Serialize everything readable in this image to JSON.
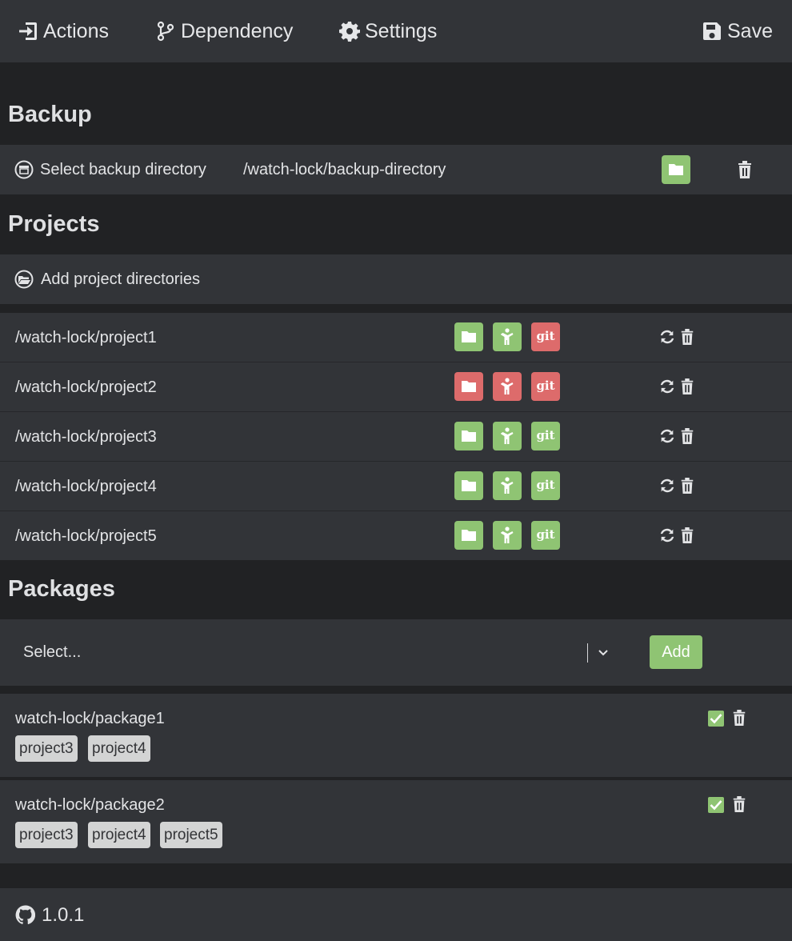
{
  "navbar": {
    "actions_label": "Actions",
    "dependency_label": "Dependency",
    "settings_label": "Settings",
    "save_label": "Save"
  },
  "backup": {
    "title": "Backup",
    "select_label": "Select backup directory",
    "directory": "/watch-lock/backup-directory",
    "folder_status": "green"
  },
  "projects": {
    "title": "Projects",
    "add_label": "Add project directories",
    "items": [
      {
        "path": "/watch-lock/project1",
        "folder": "green",
        "node": "green",
        "git": "red"
      },
      {
        "path": "/watch-lock/project2",
        "folder": "red",
        "node": "red",
        "git": "red"
      },
      {
        "path": "/watch-lock/project3",
        "folder": "green",
        "node": "green",
        "git": "green"
      },
      {
        "path": "/watch-lock/project4",
        "folder": "green",
        "node": "green",
        "git": "green"
      },
      {
        "path": "/watch-lock/project5",
        "folder": "green",
        "node": "green",
        "git": "green"
      }
    ],
    "git_label": "git"
  },
  "packages": {
    "title": "Packages",
    "select_placeholder": "Select...",
    "add_label": "Add",
    "items": [
      {
        "name": "watch-lock/package1",
        "checked": true,
        "tags": [
          "project3",
          "project4"
        ]
      },
      {
        "name": "watch-lock/package2",
        "checked": true,
        "tags": [
          "project3",
          "project4",
          "project5"
        ]
      }
    ]
  },
  "footer": {
    "version": "1.0.1"
  },
  "colors": {
    "background": "#212224",
    "panel": "#323438",
    "green": "#8fc473",
    "red": "#dd6b6b",
    "tag": "#d3d4d4"
  }
}
